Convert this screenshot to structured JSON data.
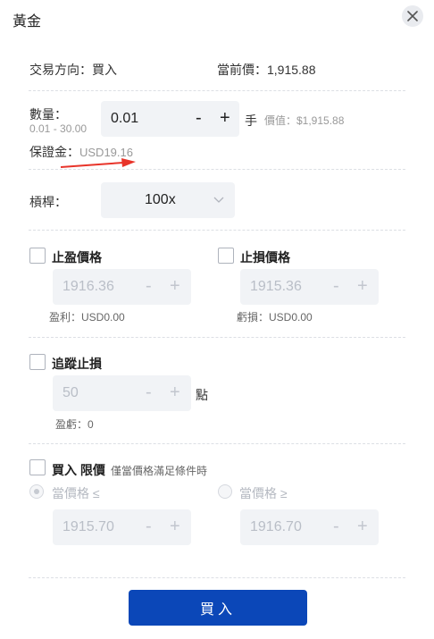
{
  "dialog": {
    "title": "黃金"
  },
  "trade": {
    "direction_label": "交易方向：",
    "direction_value": "買入",
    "price_label": "當前價：",
    "price_value": "1,915.88"
  },
  "quantity": {
    "label": "數量：",
    "range": "0.01 - 30.00",
    "value": "0.01",
    "minus": "-",
    "plus": "+",
    "unit": "手",
    "value_label": "價值：$1,915.88",
    "margin_label": "保證金：",
    "margin_value": "USD19.16"
  },
  "leverage": {
    "label": "槓桿：",
    "value": "100x"
  },
  "take_profit": {
    "label": "止盈價格",
    "value": "1916.36",
    "minus": "-",
    "plus": "+",
    "pnl": "盈利：USD0.00"
  },
  "stop_loss": {
    "label": "止損價格",
    "value": "1915.36",
    "minus": "-",
    "plus": "+",
    "pnl": "虧損：USD0.00"
  },
  "trailing_stop": {
    "label": "追蹤止損",
    "value": "50",
    "minus": "-",
    "plus": "+",
    "unit": "點",
    "pnl": "盈虧：0"
  },
  "limit": {
    "label": "買入 限價",
    "hint": "僅當價格滿足條件時",
    "opt1_label": "當價格 ≤",
    "opt2_label": "當價格 ≥",
    "value1": "1915.70",
    "value2": "1916.70",
    "minus": "-",
    "plus": "+"
  },
  "submit": {
    "label": "買入"
  },
  "colors": {
    "accent": "#0b47b8",
    "arrow": "#e8342a"
  }
}
